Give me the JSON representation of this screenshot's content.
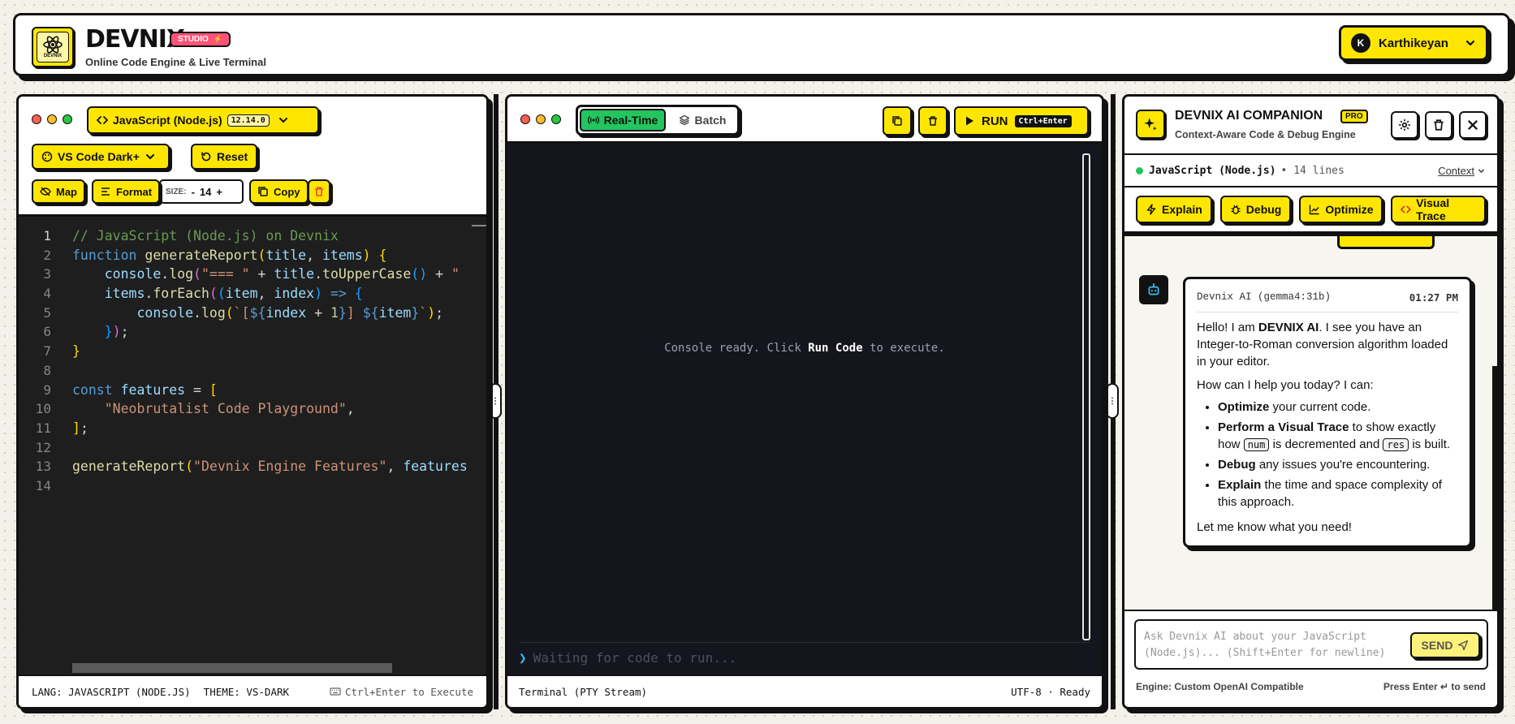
{
  "header": {
    "title": "DEVNIX",
    "badge": "STUDIO",
    "badge_icon": "⚡",
    "subtitle": "Online Code Engine & Live Terminal",
    "logo_text": "DEVNIX",
    "user": {
      "initial": "K",
      "name": "Karthikeyan"
    }
  },
  "editor": {
    "language_label": "JavaScript (Node.js)",
    "version": "12.14.0",
    "theme_label": "VS Code Dark+",
    "reset_label": "Reset",
    "map_label": "Map",
    "format_label": "Format",
    "size_label": "SIZE:",
    "size_value": "14",
    "size_minus": "-",
    "size_plus": "+",
    "copy_label": "Copy",
    "line_numbers": [
      "1",
      "2",
      "3",
      "4",
      "5",
      "6",
      "7",
      "8",
      "9",
      "10",
      "11",
      "12",
      "13",
      "14"
    ],
    "status_lang": "LANG: JAVASCRIPT (NODE.JS)",
    "status_theme": "THEME: VS-DARK",
    "status_hint": "Ctrl+Enter to Execute"
  },
  "terminal": {
    "mode_realtime": "Real-Time",
    "mode_batch": "Batch",
    "run_label": "RUN",
    "run_shortcut": "Ctrl+Enter",
    "console_ready_prefix": "Console ready. Click",
    "console_ready_bold": "Run Code",
    "console_ready_suffix": "to execute.",
    "prompt": "❯",
    "input_placeholder": "Waiting for code to run...",
    "status_left": "Terminal (PTY Stream)",
    "status_right": "UTF-8 · Ready"
  },
  "ai": {
    "title": "DEVNIX AI COMPANION",
    "pro_badge": "PRO",
    "subtitle": "Context-Aware Code & Debug Engine",
    "context_lang": "JavaScript (Node.js)",
    "context_lines": "• 14 lines",
    "context_dropdown": "Context",
    "actions": [
      "Explain",
      "Debug",
      "Optimize",
      "Visual Trace"
    ],
    "message": {
      "sender": "Devnix AI (gemma4:31b)",
      "time": "01:27 PM",
      "p1_pre": "Hello! I am",
      "p1_bold": "DEVNIX AI",
      "p1_post": ". I see you have an Integer-to-Roman conversion algorithm loaded in your editor.",
      "p2": "How can I help you today? I can:",
      "b1_bold": "Optimize",
      "b1_text": "your current code.",
      "b2_bold": "Perform a Visual Trace",
      "b2_text1": "to show exactly how",
      "b2_code1": "num",
      "b2_text2": "is decremented and",
      "b2_code2": "res",
      "b2_text3": "is built.",
      "b3_bold": "Debug",
      "b3_text": "any issues you're encountering.",
      "b4_bold": "Explain",
      "b4_text": "the time and space complexity of this approach.",
      "closing": "Let me know what you need!"
    },
    "input_placeholder": "Ask Devnix AI about your JavaScript (Node.js)... (Shift+Enter for newline)",
    "send_label": "SEND",
    "engine_label": "Engine: Custom OpenAI Compatible",
    "enter_hint": "Press Enter ↵ to send"
  },
  "colors": {
    "accent": "#ffe600",
    "badge": "#ff5277",
    "active_mode": "#22c55e",
    "editor_bg": "#1e1e1e",
    "terminal_bg": "#15161d",
    "danger": "#ef4444"
  }
}
